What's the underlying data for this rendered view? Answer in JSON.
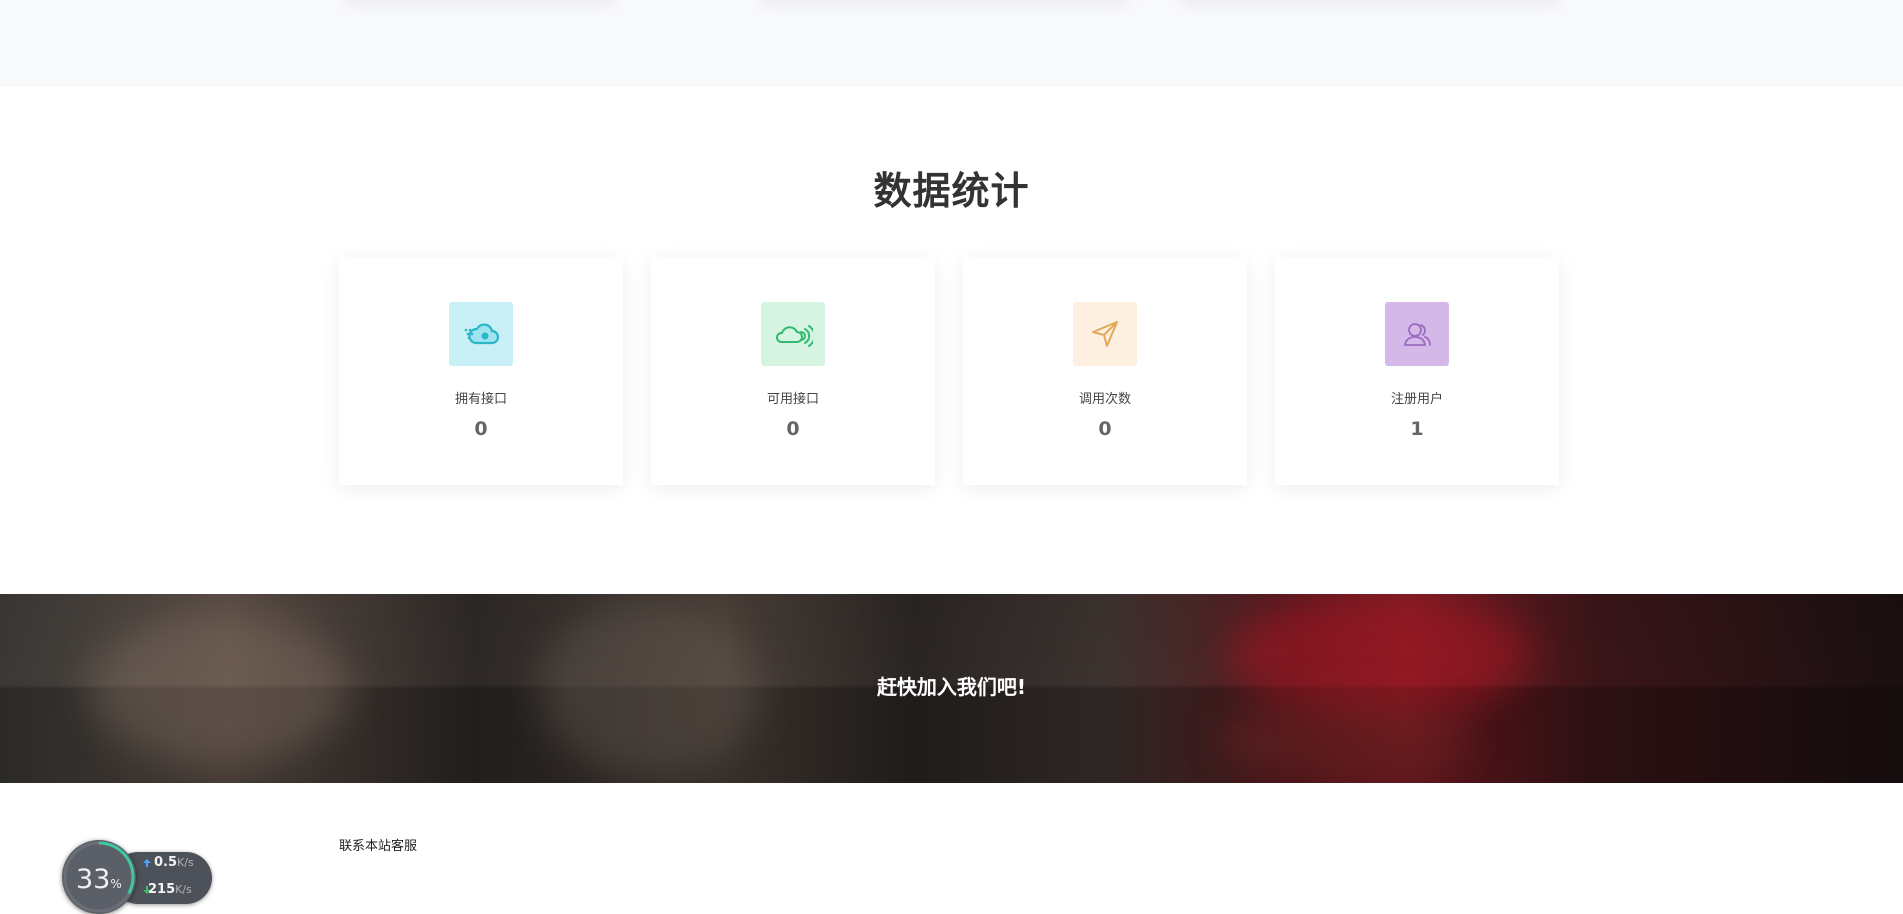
{
  "stats": {
    "title": "数据统计",
    "cards": [
      {
        "label": "拥有接口",
        "value": "0",
        "icon": "cloud-speed-icon",
        "icon_bg": "#c8f0f6",
        "icon_color": "#2cb6c9"
      },
      {
        "label": "可用接口",
        "value": "0",
        "icon": "cloud-signal-icon",
        "icon_bg": "#d6f4e2",
        "icon_color": "#36b872"
      },
      {
        "label": "调用次数",
        "value": "0",
        "icon": "send-arrow-icon",
        "icon_bg": "#fdf0e0",
        "icon_color": "#e4a95a"
      },
      {
        "label": "注册用户",
        "value": "1",
        "icon": "users-icon",
        "icon_bg": "#d3b8e8",
        "icon_color": "#9a6cc2"
      }
    ]
  },
  "banner": {
    "slogan": "赶快加入我们吧!"
  },
  "footer": {
    "contact_label": "联系本站客服"
  },
  "speed_widget": {
    "percent": "33",
    "percent_unit": "%",
    "upload_value": "0.5",
    "upload_unit": "K/s",
    "download_value": "215",
    "download_unit": "K/s",
    "ring_fraction": 0.33,
    "upload_color": "#4da3ff",
    "download_color": "#3fbf5f"
  }
}
